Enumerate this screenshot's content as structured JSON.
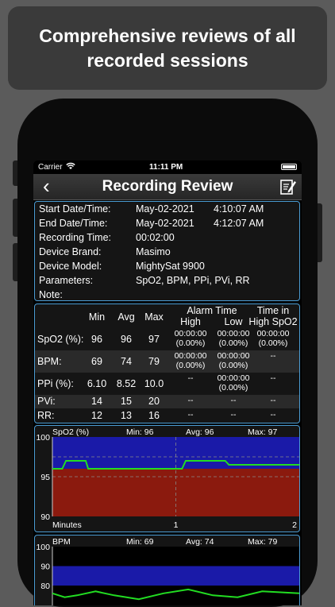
{
  "banner": {
    "text": "Comprehensive reviews of all recorded sessions"
  },
  "status_bar": {
    "carrier": "Carrier",
    "time": "11:11 PM"
  },
  "nav": {
    "back": "‹",
    "title": "Recording Review"
  },
  "info": [
    {
      "key": "Start Date/Time:",
      "value": "May-02-2021",
      "time": "4:10:07 AM"
    },
    {
      "key": "End Date/Time:",
      "value": "May-02-2021",
      "time": "4:12:07 AM"
    },
    {
      "key": "Recording Time:",
      "value": "00:02:00",
      "time": ""
    },
    {
      "key": "Device Brand:",
      "value": "Masimo",
      "time": ""
    },
    {
      "key": "Device Model:",
      "value": "MightySat 9900",
      "time": ""
    },
    {
      "key": "Parameters:",
      "value": "SpO2, BPM, PPi, PVi, RR",
      "time": ""
    },
    {
      "key": "Note:",
      "value": "",
      "time": ""
    }
  ],
  "stats": {
    "headers": {
      "min": "Min",
      "avg": "Avg",
      "max": "Max",
      "alarm_title": "Alarm Time",
      "alarm_high": "High",
      "alarm_low": "Low",
      "tih_title": "Time in",
      "tih_sub": "High SpO2"
    },
    "rows": [
      {
        "label": "SpO2 (%):",
        "min": "96",
        "avg": "96",
        "max": "97",
        "high": [
          "00:00:00",
          "(0.00%)"
        ],
        "low": [
          "00:00:00",
          "(0.00%)"
        ],
        "tih": [
          "00:00:00",
          "(0.00%)"
        ]
      },
      {
        "label": "BPM:",
        "min": "69",
        "avg": "74",
        "max": "79",
        "high": [
          "00:00:00",
          "(0.00%)"
        ],
        "low": [
          "00:00:00",
          "(0.00%)"
        ],
        "tih": [
          "--",
          ""
        ]
      },
      {
        "label": "PPi (%):",
        "min": "6.10",
        "avg": "8.52",
        "max": "10.0",
        "high": [
          "--",
          ""
        ],
        "low": [
          "00:00:00",
          "(0.00%)"
        ],
        "tih": [
          "--",
          ""
        ]
      },
      {
        "label": "PVi:",
        "min": "14",
        "avg": "15",
        "max": "20",
        "high": [
          "--",
          ""
        ],
        "low": [
          "--",
          ""
        ],
        "tih": [
          "--",
          ""
        ]
      },
      {
        "label": "RR:",
        "min": "12",
        "avg": "13",
        "max": "16",
        "high": [
          "--",
          ""
        ],
        "low": [
          "--",
          ""
        ],
        "tih": [
          "--",
          ""
        ]
      }
    ]
  },
  "charts": {
    "spo2": {
      "title": "SpO2 (%)",
      "min": "Min: 96",
      "avg": "Avg: 96",
      "max": "Max: 97",
      "xlabel": "Minutes"
    },
    "bpm": {
      "title": "BPM",
      "min": "Min: 69",
      "avg": "Avg: 74",
      "max": "Max: 79"
    }
  },
  "chart_data": [
    {
      "type": "line",
      "title": "SpO2 (%)",
      "xlabel": "Minutes",
      "ylabel": "",
      "xlim": [
        0,
        2
      ],
      "ylim": [
        90,
        100
      ],
      "x_ticks": [
        "1",
        "2"
      ],
      "y_ticks": [
        "100",
        "95",
        "90"
      ],
      "bands": [
        {
          "from": 90,
          "to": 96,
          "color": "#8b1a0e"
        },
        {
          "from": 96,
          "to": 100,
          "color": "#1a1aa8"
        }
      ],
      "series": [
        {
          "x": [
            0,
            0.08,
            0.11,
            0.27,
            0.29,
            0.42,
            1.0,
            1.05,
            1.08,
            1.4,
            1.43,
            2.0
          ],
          "y": [
            96,
            96,
            97,
            97,
            96,
            96,
            96,
            96,
            97,
            97,
            96.5,
            96.5
          ],
          "color": "#22dd22"
        }
      ],
      "reference_lines": [
        97.5,
        95
      ]
    },
    {
      "type": "line",
      "title": "BPM",
      "ylim": [
        60,
        100
      ],
      "y_ticks": [
        "100",
        "90",
        "80"
      ],
      "bands": [
        {
          "from": 80,
          "to": 90,
          "color": "#1a1aa8"
        }
      ],
      "series": [
        {
          "x": [
            0,
            0.1,
            0.2,
            0.35,
            0.5,
            0.7,
            0.9,
            1.1,
            1.3,
            1.5,
            1.7,
            2.0
          ],
          "y": [
            76,
            74,
            75,
            77,
            75,
            73,
            76,
            78,
            75,
            74,
            77,
            76
          ],
          "color": "#22dd22"
        }
      ]
    }
  ]
}
